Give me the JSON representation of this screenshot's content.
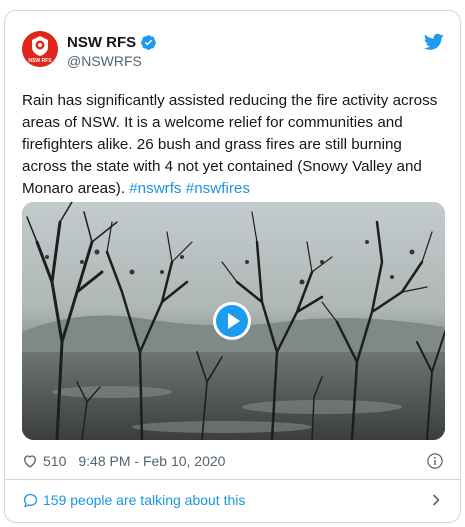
{
  "tweet": {
    "author": {
      "display_name": "NSW RFS",
      "handle": "@NSWRFS",
      "avatar_text": "NSW RFS",
      "verified": true
    },
    "text_main": "Rain has significantly assisted reducing the fire activity across areas of NSW. It is a welcome relief for communities and firefighters alike. 26 bush and grass fires are still burning across the state with 4 not yet contained (Snowy Valley and Monaro areas). ",
    "hashtags": [
      "#nswrfs",
      "#nswfires"
    ],
    "likes": "510",
    "timestamp": "9:48 PM - Feb 10, 2020",
    "talking_about": "159 people are talking about this"
  },
  "icons": {
    "bird": "twitter-bird-icon",
    "verified": "verified-badge-icon",
    "heart": "heart-icon",
    "info": "info-icon",
    "bubble": "speech-bubble-icon",
    "chevron": "chevron-right-icon",
    "play": "play-icon"
  },
  "colors": {
    "link": "#1b95e0",
    "text": "#14171a",
    "muted": "#536471",
    "border": "#cfd9de",
    "rfs_red": "#e0251b",
    "verified": "#1d9bf0"
  }
}
